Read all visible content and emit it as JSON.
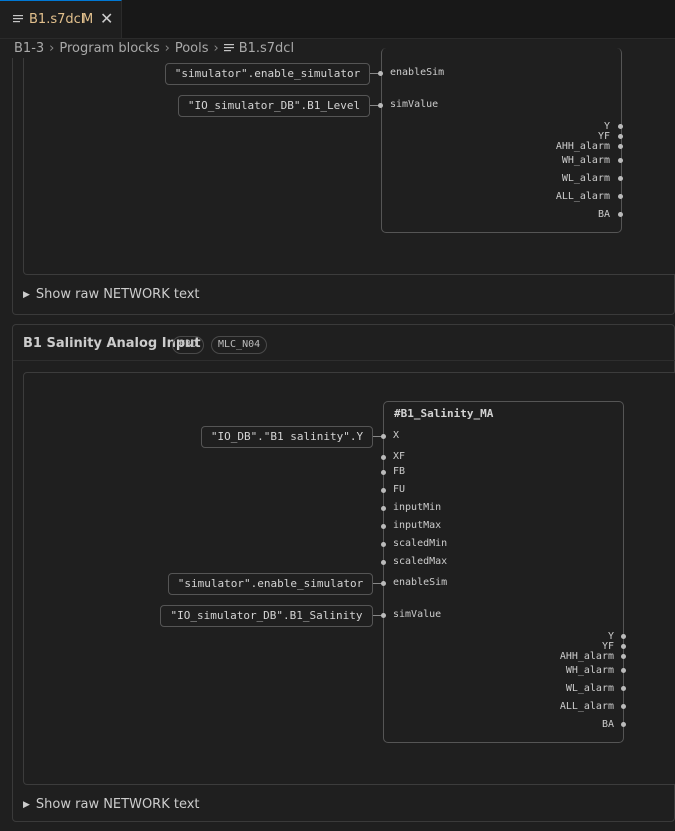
{
  "tab": {
    "title": "B1.s7dcl",
    "modified": "M",
    "close": "✕"
  },
  "breadcrumb": [
    "B1-3",
    "Program blocks",
    "Pools",
    "B1.s7dcl"
  ],
  "network1": {
    "operands": [
      {
        "value": "\"simulator\".enable_simulator",
        "pin": "enableSim"
      },
      {
        "value": "\"IO_simulator_DB\".B1_Level",
        "pin": "simValue"
      }
    ],
    "outputs": [
      "Y",
      "YF",
      "AHH_alarm",
      "WH_alarm",
      "WL_alarm",
      "ALL_alarm",
      "BA"
    ],
    "raw_label": "Show raw NETWORK text"
  },
  "network2": {
    "title": "B1 Salinity Analog Input",
    "badges": [
      "FBD",
      "MLC_N04"
    ],
    "block_name": "#B1_Salinity_MA",
    "operand_x": "\"IO_DB\".\"B1 salinity\".Y",
    "inputs": [
      "X",
      "XF",
      "FB",
      "FU",
      "inputMin",
      "inputMax",
      "scaledMin",
      "scaledMax",
      "enableSim",
      "simValue"
    ],
    "operand_enable": "\"simulator\".enable_simulator",
    "operand_sim": "\"IO_simulator_DB\".B1_Salinity",
    "outputs": [
      "Y",
      "YF",
      "AHH_alarm",
      "WH_alarm",
      "WL_alarm",
      "ALL_alarm",
      "BA"
    ],
    "raw_label": "Show raw NETWORK text"
  }
}
